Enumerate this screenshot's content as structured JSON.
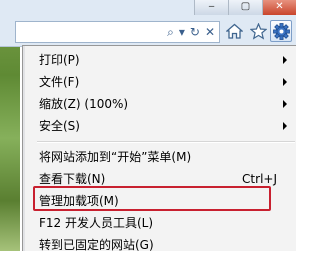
{
  "window_controls": {
    "minimize": "‒",
    "maximize": "▢",
    "close": "✕"
  },
  "address_bar": {
    "search_icon": "⌕",
    "dropdown_icon": "▾",
    "refresh_icon": "↻",
    "stop_icon": "✕"
  },
  "toolbar": {
    "home_icon": "home-icon",
    "favorites_icon": "star-icon",
    "tools_icon": "gear-icon"
  },
  "menu": {
    "items": [
      {
        "label": "打印(P)",
        "submenu": true
      },
      {
        "label": "文件(F)",
        "submenu": true
      },
      {
        "label": "缩放(Z) (100%)",
        "submenu": true
      },
      {
        "label": "安全(S)",
        "submenu": true
      },
      {
        "label": "将网站添加到“开始”菜单(M)"
      },
      {
        "label": "查看下载(N)",
        "shortcut": "Ctrl+J"
      },
      {
        "label": "管理加载项(M)",
        "highlighted": true
      },
      {
        "label": "F12 开发人员工具(L)"
      },
      {
        "label": "转到已固定的网站(G)"
      }
    ]
  },
  "colors": {
    "highlight_border": "#c8202f",
    "chrome_background": "#dfe9f4"
  }
}
